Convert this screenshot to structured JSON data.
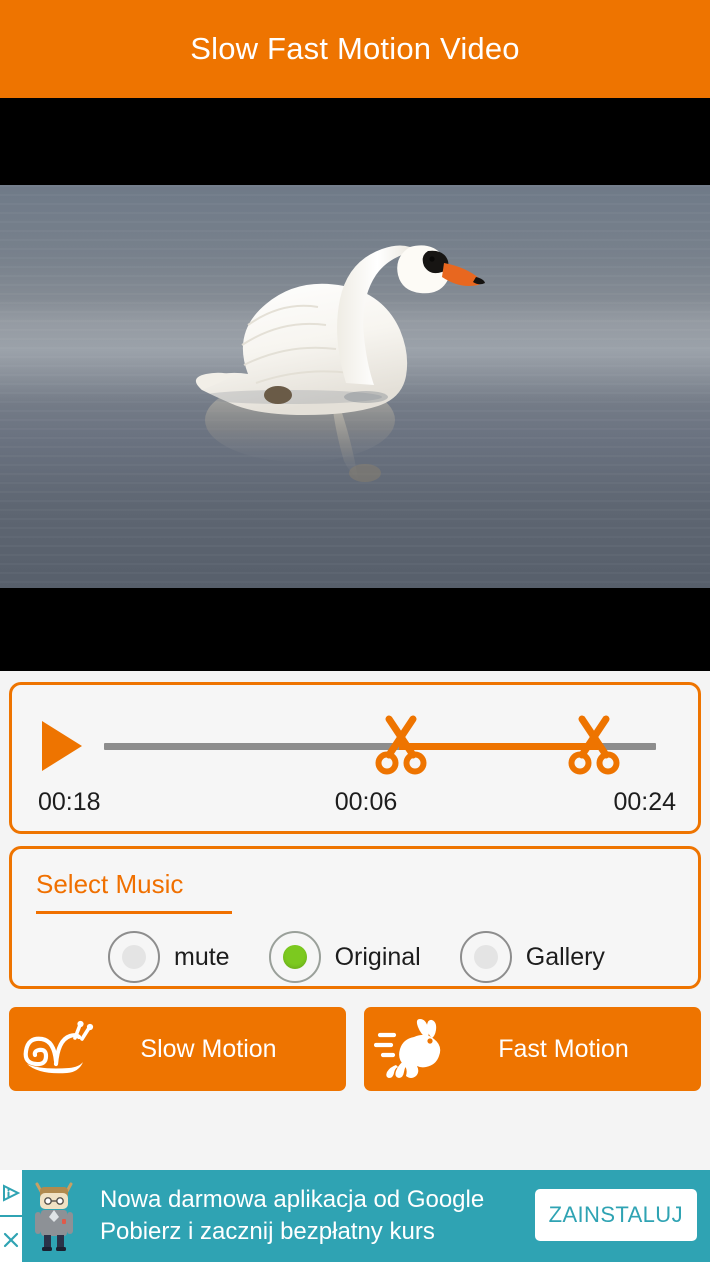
{
  "header": {
    "title": "Slow Fast Motion Video"
  },
  "video": {
    "scene_description": "White mute swan swimming on gray-blue water with reflection",
    "letterbox_color": "#000000"
  },
  "player": {
    "play_icon": "play-triangle-icon",
    "trim_handle_icon": "scissors-icon",
    "track_color": "#8d8d8d",
    "selection_color": "#ee7400",
    "current_time": "00:18",
    "start_time": "00:06",
    "end_time": "00:24"
  },
  "music": {
    "section_label": "Select Music",
    "options": [
      {
        "label": "mute",
        "selected": false
      },
      {
        "label": "Original",
        "selected": true
      },
      {
        "label": "Gallery",
        "selected": false
      }
    ],
    "selected_color": "#7cc91f"
  },
  "actions": {
    "slow": {
      "label": "Slow Motion",
      "icon": "snail-icon"
    },
    "fast": {
      "label": "Fast Motion",
      "icon": "rabbit-icon"
    }
  },
  "ad": {
    "line1": "Nowa darmowa aplikacja od Google",
    "line2": "Pobierz i zacznij bezpłatny kurs",
    "cta": "ZAINSTALUJ",
    "adchoices_icon": "adchoices-icon",
    "close_icon": "close-x-icon",
    "avatar_icon": "android-person-icon",
    "background_color": "#2fa3b3"
  },
  "theme": {
    "accent": "#ee7400",
    "panel_bg": "#f6f6f6",
    "page_bg": "#f4f4f4"
  }
}
